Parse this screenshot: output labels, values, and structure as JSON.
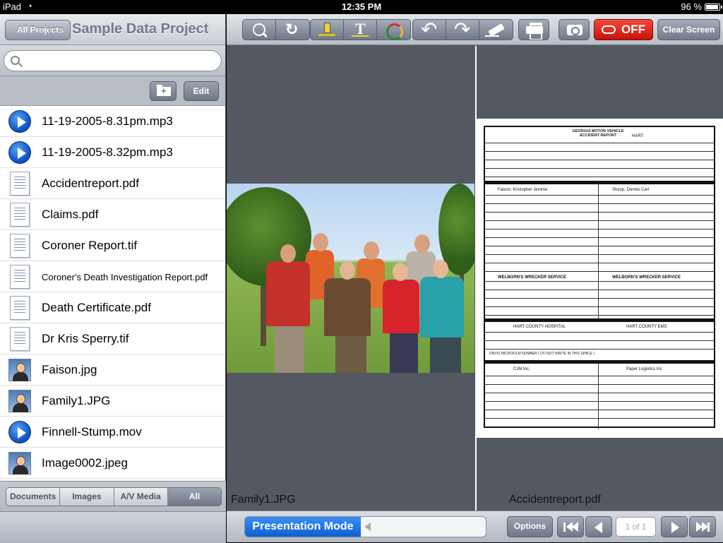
{
  "status_bar": {
    "device": "iPad",
    "time": "12:35 PM",
    "battery": "96 %"
  },
  "sidebar": {
    "back_label": "All Projects",
    "title": "Sample Data Project",
    "search_placeholder": "",
    "edit_label": "Edit",
    "files": [
      {
        "name": "11-19-2005-8.31pm.mp3",
        "icon": "play-icon"
      },
      {
        "name": "11-19-2005-8.32pm.mp3",
        "icon": "play-icon"
      },
      {
        "name": "Accidentreport.pdf",
        "icon": "document-icon"
      },
      {
        "name": "Claims.pdf",
        "icon": "document-icon"
      },
      {
        "name": "Coroner Report.tif",
        "icon": "document-icon"
      },
      {
        "name": "Coroner's Death Investigation Report.pdf",
        "icon": "document-icon"
      },
      {
        "name": "Death Certificate.pdf",
        "icon": "document-icon"
      },
      {
        "name": "Dr Kris Sperry.tif",
        "icon": "document-icon"
      },
      {
        "name": "Faison.jpg",
        "icon": "image-icon"
      },
      {
        "name": "Family1.JPG",
        "icon": "image-icon"
      },
      {
        "name": "Finnell-Stump.mov",
        "icon": "play-icon"
      },
      {
        "name": "Image0002.jpeg",
        "icon": "image-icon"
      }
    ],
    "filters": [
      "Documents",
      "Images",
      "A/V Media",
      "All"
    ],
    "active_filter": "All"
  },
  "toolbar": {
    "record_label": "OFF",
    "clear_label": "Clear Screen",
    "record_color": "#d8251a"
  },
  "viewer": {
    "left_caption": "Family1.JPG",
    "right_caption": "Accidentreport.pdf"
  },
  "bottom": {
    "presentation_label": "Presentation Mode",
    "options_label": "Options",
    "page_indicator": "1 of 1"
  },
  "report": {
    "header": "GEORGIA MOTOR VEHICLE ACCIDENT REPORT",
    "county": "HART",
    "driver1_name": "Faison, Kristopher Jerome",
    "driver2_name": "Stump, Dennis Carl",
    "hospital": "HART COUNTY HOSPITAL",
    "ems": "HART COUNTY EMS",
    "wrecker": "WELBORN'S WRECKER SERVICE",
    "carrier1": "CJM Inc.",
    "carrier2": "Paper Logistics Inc",
    "microfilm": "DNVIS MICROFILM NUMBER ( DO NOT WRITE IN THIS SPACE )"
  }
}
